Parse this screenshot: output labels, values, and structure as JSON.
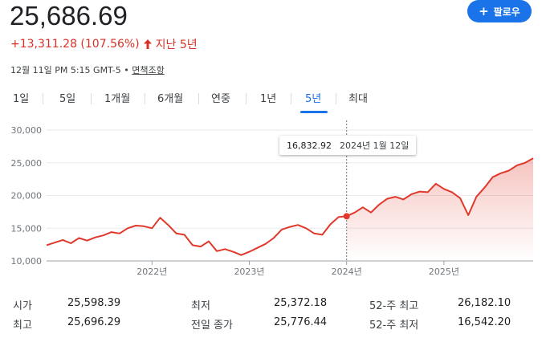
{
  "header": {
    "price": "25,686.69",
    "change": "+13,311.28 (107.56%)",
    "change_arrow_icon": "arrow-up-icon",
    "period_label": "지난 5년",
    "timestamp": "12월 11일 PM 5:15 GMT-5",
    "separator": " • ",
    "disclaimer": "면책조항",
    "follow_button": "팔로우",
    "follow_icon": "plus-icon"
  },
  "tabs": [
    {
      "label": "1일"
    },
    {
      "label": "5일"
    },
    {
      "label": "1개월"
    },
    {
      "label": "6개월"
    },
    {
      "label": "연중"
    },
    {
      "label": "1년"
    },
    {
      "label": "5년",
      "active": true
    },
    {
      "label": "최대"
    }
  ],
  "tooltip": {
    "value": "16,832.92",
    "date": "2024년 1월 12일"
  },
  "colors": {
    "line": "#e0392b",
    "accent": "#1a73e8",
    "negative": "#d93025"
  },
  "chart_data": {
    "type": "area",
    "ylim": [
      10000,
      30000
    ],
    "y_ticks": [
      "30,000",
      "25,000",
      "20,000",
      "15,000",
      "10,000"
    ],
    "x_ticks": [
      "2022년",
      "2023년",
      "2024년",
      "2025년"
    ],
    "grid": true,
    "hover_index": 37,
    "x": [
      "2020-12",
      "2021-01",
      "2021-02",
      "2021-03",
      "2021-04",
      "2021-05",
      "2021-06",
      "2021-07",
      "2021-08",
      "2021-09",
      "2021-10",
      "2021-11",
      "2021-12",
      "2022-01",
      "2022-02",
      "2022-03",
      "2022-04",
      "2022-05",
      "2022-06",
      "2022-07",
      "2022-08",
      "2022-09",
      "2022-10",
      "2022-11",
      "2022-12",
      "2023-01",
      "2023-02",
      "2023-03",
      "2023-04",
      "2023-05",
      "2023-06",
      "2023-07",
      "2023-08",
      "2023-09",
      "2023-10",
      "2023-11",
      "2023-12",
      "2024-01",
      "2024-02",
      "2024-03",
      "2024-04",
      "2024-05",
      "2024-06",
      "2024-07",
      "2024-08",
      "2024-09",
      "2024-10",
      "2024-11",
      "2024-12",
      "2025-01",
      "2025-02",
      "2025-03",
      "2025-04",
      "2025-05",
      "2025-06",
      "2025-07",
      "2025-08",
      "2025-09",
      "2025-10",
      "2025-11",
      "2025-12"
    ],
    "series": [
      {
        "values": [
          12400,
          12800,
          13200,
          12700,
          13500,
          13100,
          13600,
          13900,
          14400,
          14200,
          15000,
          15400,
          15300,
          15000,
          16600,
          15500,
          14200,
          14000,
          12400,
          12200,
          13000,
          11500,
          11800,
          11400,
          10900,
          11400,
          12000,
          12600,
          13500,
          14800,
          15200,
          15500,
          15000,
          14200,
          14000,
          15600,
          16700,
          16830,
          17400,
          18200,
          17400,
          18600,
          19500,
          19800,
          19400,
          20200,
          20600,
          20500,
          21800,
          21000,
          20500,
          19600,
          17000,
          19800,
          21200,
          22800,
          23400,
          23800,
          24600,
          25000,
          25690
        ]
      }
    ]
  },
  "stats": [
    {
      "label": "시가",
      "value": "25,598.39"
    },
    {
      "label": "최저",
      "value": "25,372.18"
    },
    {
      "label": "52-주 최고",
      "value": "26,182.10"
    },
    {
      "label": "최고",
      "value": "25,696.29"
    },
    {
      "label": "전일 종가",
      "value": "25,776.44"
    },
    {
      "label": "52-주 최저",
      "value": "16,542.20"
    }
  ]
}
